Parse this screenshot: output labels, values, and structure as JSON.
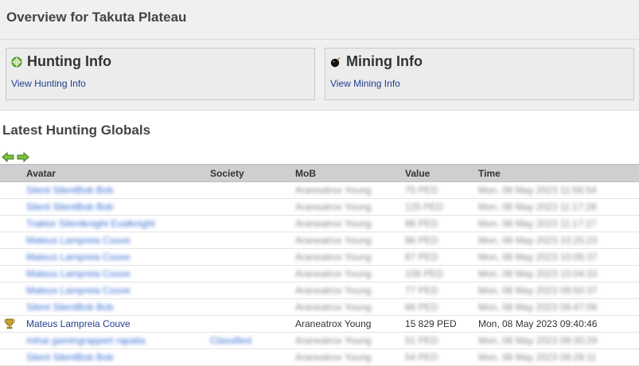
{
  "page": {
    "title": "Overview for Takuta Plateau"
  },
  "boxes": {
    "hunting": {
      "title": "Hunting Info",
      "link": "View Hunting Info",
      "icon": "crosshair-icon"
    },
    "mining": {
      "title": "Mining Info",
      "link": "View Mining Info",
      "icon": "bomb-icon"
    }
  },
  "globals": {
    "title": "Latest Hunting Globals",
    "nav": {
      "prev_icon": "arrow-left-icon",
      "next_icon": "arrow-right-icon"
    },
    "columns": {
      "icon": "",
      "avatar": "Avatar",
      "society": "Society",
      "mob": "MoB",
      "value": "Value",
      "time": "Time"
    },
    "rows": [
      {
        "icon": "",
        "avatar": "Silent SilentBob Bob",
        "society": "",
        "mob": "Araneatrox Young",
        "value": "75 PED",
        "time": "Mon, 08 May 2023 11:56:54",
        "blurred": true
      },
      {
        "icon": "",
        "avatar": "Silent SilentBob Bob",
        "society": "",
        "mob": "Araneatrox Young",
        "value": "125 PED",
        "time": "Mon, 08 May 2023 11:17:28",
        "blurred": true
      },
      {
        "icon": "",
        "avatar": "Traktor Silentknight Evalknight",
        "society": "",
        "mob": "Araneatrox Young",
        "value": "86 PED",
        "time": "Mon, 08 May 2023 11:17:27",
        "blurred": true
      },
      {
        "icon": "",
        "avatar": "Mateus Lampreia Couve",
        "society": "",
        "mob": "Araneatrox Young",
        "value": "86 PED",
        "time": "Mon, 08 May 2023 10:25:23",
        "blurred": true
      },
      {
        "icon": "",
        "avatar": "Mateus Lampreia Couve",
        "society": "",
        "mob": "Araneatrox Young",
        "value": "67 PED",
        "time": "Mon, 08 May 2023 10:06:37",
        "blurred": true
      },
      {
        "icon": "",
        "avatar": "Mateus Lampreia Couve",
        "society": "",
        "mob": "Araneatrox Young",
        "value": "106 PED",
        "time": "Mon, 08 May 2023 10:04:33",
        "blurred": true
      },
      {
        "icon": "",
        "avatar": "Mateus Lampreia Couve",
        "society": "",
        "mob": "Araneatrox Young",
        "value": "77 PED",
        "time": "Mon, 08 May 2023 09:50:37",
        "blurred": true
      },
      {
        "icon": "",
        "avatar": "Silent SilentBob Bob",
        "society": "",
        "mob": "Araneatrox Young",
        "value": "86 PED",
        "time": "Mon, 08 May 2023 09:47:06",
        "blurred": true
      },
      {
        "icon": "trophy-icon",
        "avatar": "Mateus Lampreia Couve",
        "society": "",
        "mob": "Araneatrox Young",
        "value": "15 829 PED",
        "time": "Mon, 08 May 2023 09:40:46",
        "blurred": false
      },
      {
        "icon": "",
        "avatar": "mihai gamingrappert rapatia",
        "society": "Classified",
        "mob": "Araneatrox Young",
        "value": "51 PED",
        "time": "Mon, 08 May 2023 09:30:29",
        "blurred": true
      },
      {
        "icon": "",
        "avatar": "Silent SilentBob Bob",
        "society": "",
        "mob": "Araneatrox Young",
        "value": "54 PED",
        "time": "Mon, 08 May 2023 09:28:11",
        "blurred": true
      }
    ]
  }
}
